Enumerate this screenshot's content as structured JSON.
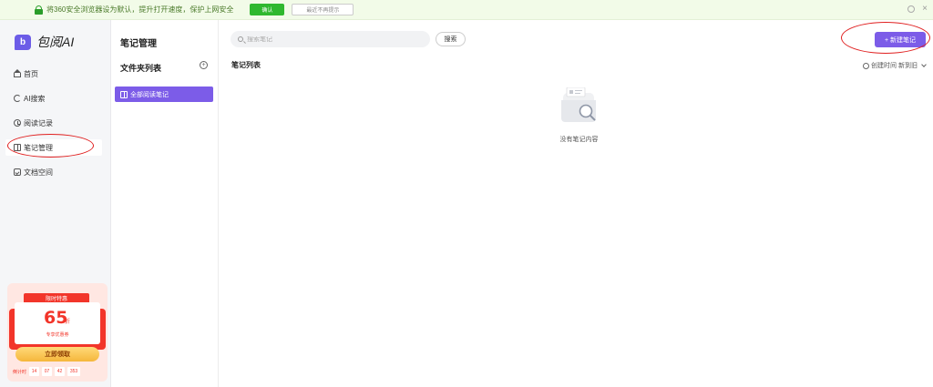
{
  "notice": {
    "text": "将360安全浏览器设为默认，提升打开速度，保护上网安全",
    "confirm_label": "确认",
    "never_label": "最近不再提示",
    "close_glyph": "×"
  },
  "sidebar": {
    "logo_mark": "b",
    "logo_text": "包阅AI",
    "items": [
      {
        "label": "首页",
        "icon": "home-icon"
      },
      {
        "label": "AI搜索",
        "icon": "ai-search-icon"
      },
      {
        "label": "阅读记录",
        "icon": "clock-icon"
      },
      {
        "label": "笔记管理",
        "icon": "book-icon"
      },
      {
        "label": "文档空间",
        "icon": "doc-icon"
      }
    ]
  },
  "promo": {
    "ribbon": "限时特惠",
    "discount": "65",
    "unit": "折",
    "subtitle": "专享优惠券",
    "button": "立即领取",
    "countdown_label": "倒计时",
    "countdown": [
      "14",
      "07",
      "42",
      "353"
    ]
  },
  "folders": {
    "title": "笔记管理",
    "subtitle": "文件夹列表",
    "add_glyph": "+",
    "items": [
      {
        "label": "全部阅读笔记"
      }
    ]
  },
  "main": {
    "search_placeholder": "搜索笔记",
    "search_button": "搜索",
    "new_button": "+ 新建笔记",
    "list_title": "笔记列表",
    "sort_label": "创建时间 新到旧",
    "empty_text": "没有笔记内容"
  },
  "colors": {
    "accent": "#7c5ce8",
    "notice_bg": "#f2fbe8",
    "confirm_green": "#2fb82f",
    "promo_red": "#f2352a",
    "highlight_ring": "#e02020"
  }
}
